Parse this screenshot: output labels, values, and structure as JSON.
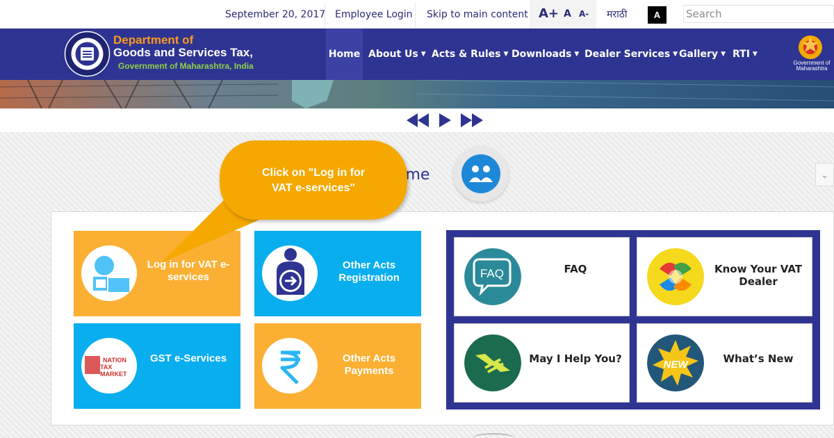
{
  "topbar": {
    "date": "September 20, 2017",
    "employee_login": "Employee Login",
    "skip": "Skip to main content",
    "font_increase": "A+",
    "font_normal": "A",
    "font_decrease": "A-",
    "language": "मराठी",
    "contrast": "A",
    "search_placeholder": "Search"
  },
  "header": {
    "dept_line1": "Department of",
    "dept_line2": "Goods and Services Tax,",
    "dept_line3": "Government of Maharashtra, India",
    "gov_label_1": "Government of",
    "gov_label_2": "Maharashtra",
    "nav": {
      "home": "Home",
      "about": "About Us",
      "acts": "Acts & Rules",
      "downloads": "Downloads",
      "dealer": "Dealer Services",
      "gallery": "Gallery",
      "rti": "RTI"
    }
  },
  "main": {
    "welcome": "ome",
    "callout_line1": "Click on \"Log in for",
    "callout_line2": "VAT e-services\"",
    "tiles": {
      "login_vat_1": "Log in for VAT e-",
      "login_vat_2": "services",
      "other_reg_1": "Other Acts",
      "other_reg_2": "Registration",
      "gst": "GST e-Services",
      "other_pay_1": "Other Acts",
      "other_pay_2": "Payments"
    },
    "cards": {
      "faq": "FAQ",
      "faq_icon_text": "FAQ",
      "know_1": "Know Your VAT",
      "know_2": "Dealer",
      "help": "May I Help You?",
      "whats_new": "What’s New",
      "new_badge": "NEW"
    },
    "logo_ntm_1": "NATION",
    "logo_ntm_2": "TAX",
    "logo_ntm_3": "MARKET"
  },
  "colors": {
    "primary": "#2e3491",
    "accent_orange": "#fbb034",
    "accent_cyan": "#09aeef",
    "callout": "#f5a800"
  }
}
